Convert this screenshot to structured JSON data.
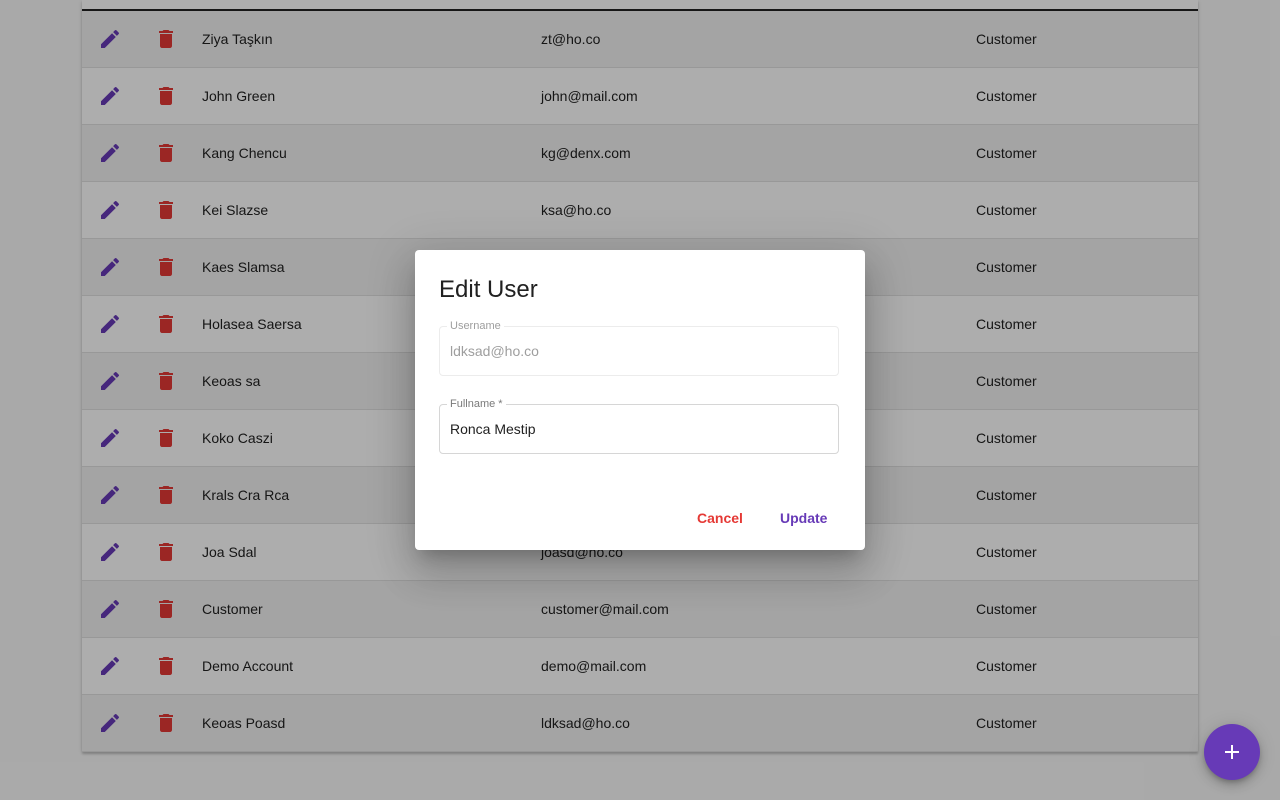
{
  "colors": {
    "primary": "#673ab7",
    "warn": "#e53935"
  },
  "table": {
    "rows": [
      {
        "name": "Ziya Taşkın",
        "email": "zt@ho.co",
        "role": "Customer"
      },
      {
        "name": "John Green",
        "email": "john@mail.com",
        "role": "Customer"
      },
      {
        "name": "Kang Chencu",
        "email": "kg@denx.com",
        "role": "Customer"
      },
      {
        "name": "Kei Slazse",
        "email": "ksa@ho.co",
        "role": "Customer"
      },
      {
        "name": "Kaes Slamsa",
        "email": "",
        "role": "Customer"
      },
      {
        "name": "Holasea Saersa",
        "email": "",
        "role": "Customer"
      },
      {
        "name": "Keoas sa",
        "email": "",
        "role": "Customer"
      },
      {
        "name": "Koko Caszi",
        "email": "",
        "role": "Customer"
      },
      {
        "name": "Krals Cra Rca",
        "email": "",
        "role": "Customer"
      },
      {
        "name": "Joa Sdal",
        "email": "joasd@ho.co",
        "role": "Customer"
      },
      {
        "name": "Customer",
        "email": "customer@mail.com",
        "role": "Customer"
      },
      {
        "name": "Demo Account",
        "email": "demo@mail.com",
        "role": "Customer"
      },
      {
        "name": "Keoas Poasd",
        "email": "ldksad@ho.co",
        "role": "Customer"
      }
    ],
    "row_icons": {
      "edit": "pencil-icon",
      "delete": "trash-icon"
    }
  },
  "dialog": {
    "title": "Edit User",
    "username_label": "Username",
    "username_value": "ldksad@ho.co",
    "fullname_label": "Fullname *",
    "fullname_value": "Ronca Mestip",
    "cancel_label": "Cancel",
    "update_label": "Update"
  },
  "fab": {
    "icon": "plus-icon"
  }
}
